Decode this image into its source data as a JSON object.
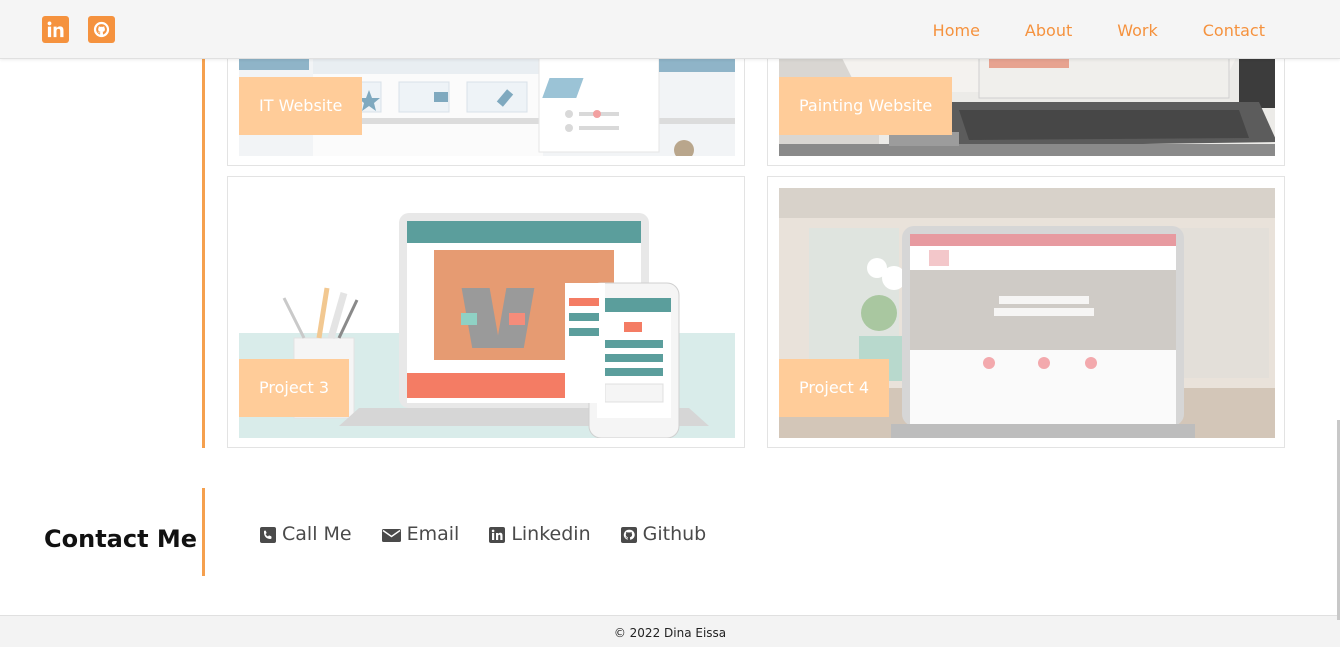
{
  "header": {
    "social": [
      {
        "name": "linkedin-icon"
      },
      {
        "name": "github-icon"
      }
    ],
    "nav": [
      "Home",
      "About",
      "Work",
      "Contact"
    ]
  },
  "work": {
    "projects": [
      {
        "label": "IT Website"
      },
      {
        "label": "Painting Website"
      },
      {
        "label": "Project 3"
      },
      {
        "label": "Project 4"
      }
    ]
  },
  "contact": {
    "title": "Contact Me",
    "links": [
      {
        "label": "Call Me",
        "icon": "phone-icon"
      },
      {
        "label": "Email",
        "icon": "envelope-icon"
      },
      {
        "label": "Linkedin",
        "icon": "linkedin-icon"
      },
      {
        "label": "Github",
        "icon": "github-icon"
      }
    ]
  },
  "footer": {
    "text": "© 2022 Dina Eissa"
  },
  "colors": {
    "accent": "#f5923e",
    "label_bg": "#ffcc99"
  }
}
